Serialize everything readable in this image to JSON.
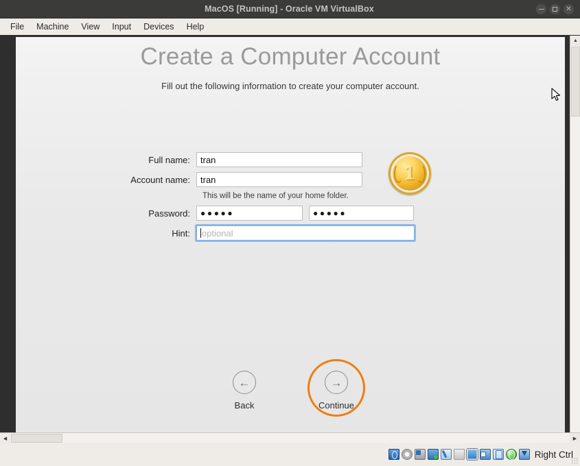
{
  "window": {
    "title": "MacOS [Running] - Oracle VM VirtualBox",
    "buttons": {
      "minimize": "minimize",
      "maximize": "maximize",
      "close": "close"
    }
  },
  "menubar": {
    "items": [
      {
        "label": "File"
      },
      {
        "label": "Machine"
      },
      {
        "label": "View"
      },
      {
        "label": "Input"
      },
      {
        "label": "Devices"
      },
      {
        "label": "Help"
      }
    ]
  },
  "installer": {
    "title": "Create a Computer Account",
    "subtitle": "Fill out the following information to create your computer account.",
    "fields": {
      "full_name": {
        "label": "Full name:",
        "value": "tran"
      },
      "account_name": {
        "label": "Account name:",
        "value": "tran",
        "helper": "This will be the name of your home folder."
      },
      "password": {
        "label": "Password:",
        "value": "●●●●●"
      },
      "password_verify": {
        "value": "●●●●●"
      },
      "hint": {
        "label": "Hint:",
        "value": "",
        "placeholder": "optional"
      }
    },
    "avatar": {
      "name": "gold-coin-avatar",
      "number": "1"
    },
    "buttons": {
      "back": {
        "label": "Back",
        "icon": "←"
      },
      "continue": {
        "label": "Continue",
        "icon": "→"
      }
    },
    "highlight_color": "#f07d10"
  },
  "statusbar": {
    "icons": [
      {
        "name": "hard-disk-icon"
      },
      {
        "name": "optical-disk-icon"
      },
      {
        "name": "floppy-disk-icon"
      },
      {
        "name": "network-icon"
      },
      {
        "name": "usb-icon"
      },
      {
        "name": "shared-folders-icon"
      },
      {
        "name": "display-icon"
      },
      {
        "name": "multi-screen-icon"
      },
      {
        "name": "video-capture-icon"
      },
      {
        "name": "guest-additions-icon"
      },
      {
        "name": "host-key-icon"
      }
    ],
    "host_key": "Right Ctrl"
  },
  "scrollbars": {
    "vertical": {
      "up": "▲",
      "down": "▼"
    },
    "horizontal": {
      "left": "◀",
      "right": "▶"
    }
  }
}
